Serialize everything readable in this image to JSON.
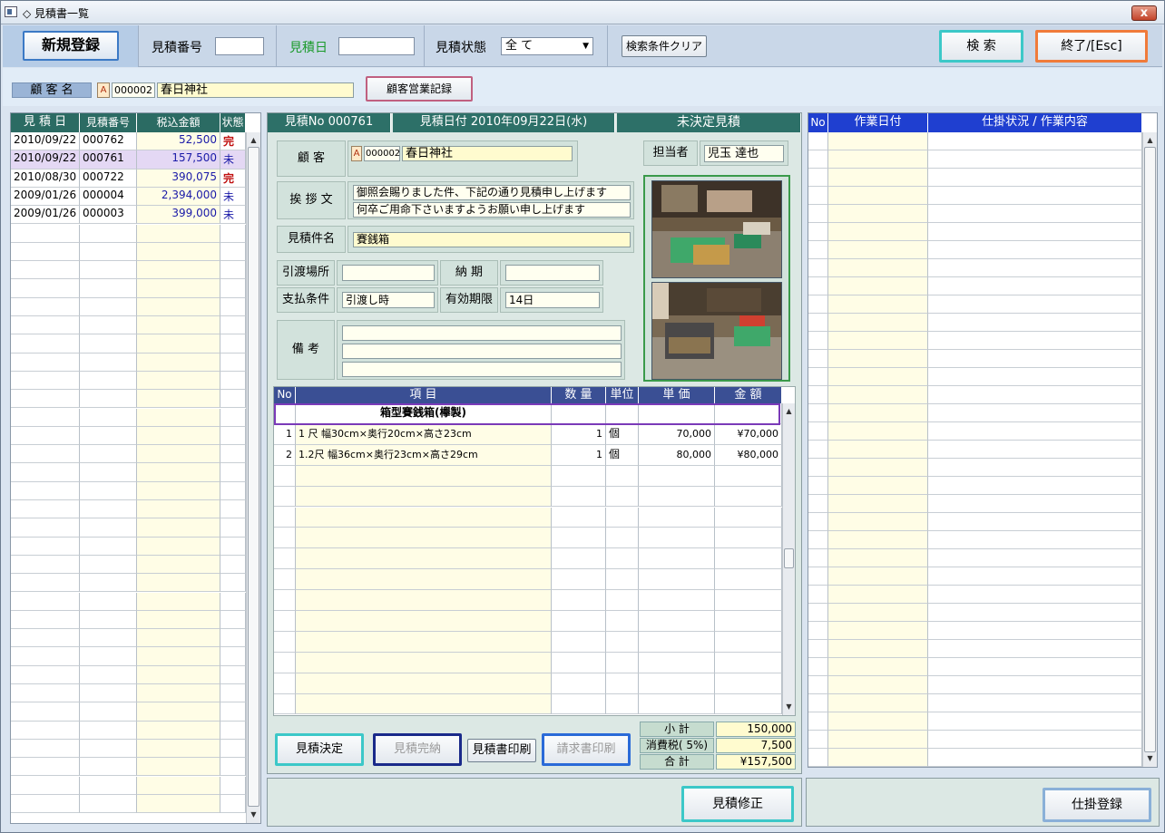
{
  "window": {
    "title": "◇ 見積書一覧",
    "close_label": "x"
  },
  "toolbar": {
    "new_label": "新規登録",
    "estimate_no_label": "見積番号",
    "estimate_date_label": "見積日",
    "status_label": "見積状態",
    "status_value": "全 て",
    "clear_label": "検索条件クリア",
    "search_label": "検 索",
    "exit_label": "終了/[Esc]"
  },
  "customer_bar": {
    "label": "顧 客 名",
    "kind": "A",
    "code": "000002",
    "name": "春日神社",
    "history_button": "顧客営業記録"
  },
  "list": {
    "headers": [
      "見 積 日",
      "見積番号",
      "税込金額",
      "状態"
    ],
    "rows": [
      {
        "date": "2010/09/22",
        "no": "000762",
        "amount": "52,500",
        "status": "完"
      },
      {
        "date": "2010/09/22",
        "no": "000761",
        "amount": "157,500",
        "status": "未"
      },
      {
        "date": "2010/08/30",
        "no": "000722",
        "amount": "390,075",
        "status": "完"
      },
      {
        "date": "2009/01/26",
        "no": "000004",
        "amount": "2,394,000",
        "status": "未"
      },
      {
        "date": "2009/01/26",
        "no": "000003",
        "amount": "399,000",
        "status": "未"
      }
    ]
  },
  "detail": {
    "header_no": "見積No 000761",
    "header_date": "見積日付 2010年09月22日(水)",
    "header_status": "未決定見積",
    "customer_label": "顧 客",
    "customer_kind": "A",
    "customer_code": "000002",
    "customer_name": "春日神社",
    "staff_label": "担当者",
    "staff_name": "児玉 達也",
    "greeting_label": "挨 拶 文",
    "greeting_1": "御照会賜りました件、下記の通り見積申し上げます",
    "greeting_2": "何卒ご用命下さいますようお願い申し上げます",
    "subject_label": "見積件名",
    "subject_value": "賽銭箱",
    "delivery_place_label": "引渡場所",
    "delivery_place_value": "",
    "delivery_date_label": "納 期",
    "delivery_date_value": "",
    "payment_label": "支払条件",
    "payment_value": "引渡し時",
    "validity_label": "有効期限",
    "validity_value": "14日",
    "remarks_label": "備 考"
  },
  "items": {
    "headers": [
      "No",
      "項 目",
      "数 量",
      "単位",
      "単 価",
      "金 額"
    ],
    "group_title": "箱型賽銭箱(欅製)",
    "rows": [
      {
        "no": "1",
        "name": "1 尺 幅30cm×奥行20cm×高さ23cm",
        "qty": "1",
        "unit": "個",
        "price": "70,000",
        "amount": "¥70,000"
      },
      {
        "no": "2",
        "name": "1.2尺 幅36cm×奥行23cm×高さ29cm",
        "qty": "1",
        "unit": "個",
        "price": "80,000",
        "amount": "¥80,000"
      }
    ]
  },
  "totals": {
    "subtotal_label": "小 計",
    "subtotal_value": "150,000",
    "tax_label": "消費税( 5%)",
    "tax_value": "7,500",
    "total_label": "合 計",
    "total_value": "¥157,500"
  },
  "actions": {
    "decide": "見積決定",
    "complete": "見積完納",
    "print_estimate": "見積書印刷",
    "print_invoice": "請求書印刷",
    "modify": "見積修正",
    "work_register": "仕掛登録"
  },
  "work": {
    "headers": [
      "No",
      "作業日付",
      "仕掛状況 / 作業内容"
    ]
  }
}
